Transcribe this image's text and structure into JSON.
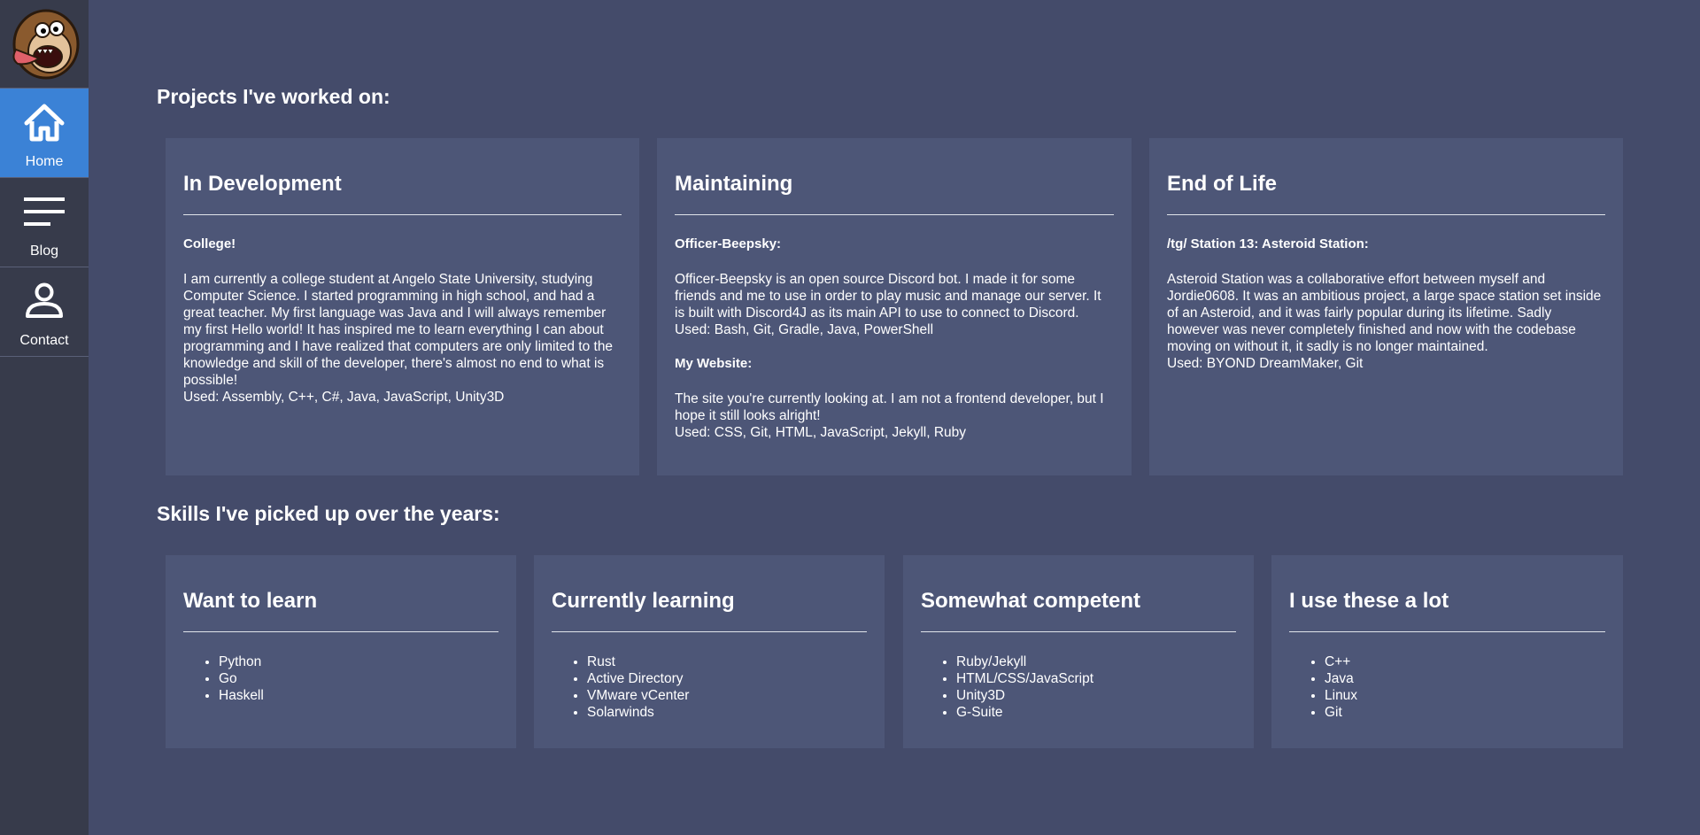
{
  "sidebar": {
    "logo_alt": "monkey-avatar",
    "items": [
      {
        "label": "Home",
        "icon": "home-icon",
        "active": true
      },
      {
        "label": "Blog",
        "icon": "menu-icon",
        "active": false
      },
      {
        "label": "Contact",
        "icon": "user-icon",
        "active": false
      }
    ]
  },
  "projects": {
    "heading": "Projects I've worked on:",
    "cards": [
      {
        "title": "In Development",
        "entries": [
          {
            "name": "College!",
            "description": "I am currently a college student at Angelo State University, studying Computer Science. I started programming in high school, and had a great teacher. My first language was Java and I will always remember my first Hello world! It has inspired me to learn everything I can about programming and I have realized that computers are only limited to the knowledge and skill of the developer, there's almost no end to what is possible!",
            "used": "Used: Assembly, C++, C#, Java, JavaScript, Unity3D"
          }
        ]
      },
      {
        "title": "Maintaining",
        "entries": [
          {
            "name": "Officer-Beepsky:",
            "description": "Officer-Beepsky is an open source Discord bot. I made it for some friends and me to use in order to play music and manage our server. It is built with Discord4J as its main API to use to connect to Discord.",
            "used": "Used: Bash, Git, Gradle, Java, PowerShell"
          },
          {
            "name": "My Website:",
            "description": "The site you're currently looking at. I am not a frontend developer, but I hope it still looks alright!",
            "used": "Used: CSS, Git, HTML, JavaScript, Jekyll, Ruby"
          }
        ]
      },
      {
        "title": "End of Life",
        "entries": [
          {
            "name": "/tg/ Station 13: Asteroid Station:",
            "description": "Asteroid Station was a collaborative effort between myself and Jordie0608. It was an ambitious project, a large space station set inside of an Asteroid, and it was fairly popular during its lifetime. Sadly however was never completely finished and now with the codebase moving on without it, it sadly is no longer maintained.",
            "used": "Used: BYOND DreamMaker, Git"
          }
        ]
      }
    ]
  },
  "skills": {
    "heading": "Skills I've picked up over the years:",
    "cards": [
      {
        "title": "Want to learn",
        "items": [
          "Python",
          "Go",
          "Haskell"
        ]
      },
      {
        "title": "Currently learning",
        "items": [
          "Rust",
          "Active Directory",
          "VMware vCenter",
          "Solarwinds"
        ]
      },
      {
        "title": "Somewhat competent",
        "items": [
          "Ruby/Jekyll",
          "HTML/CSS/JavaScript",
          "Unity3D",
          "G-Suite"
        ]
      },
      {
        "title": "I use these a lot",
        "items": [
          "C++",
          "Java",
          "Linux",
          "Git"
        ]
      }
    ]
  }
}
